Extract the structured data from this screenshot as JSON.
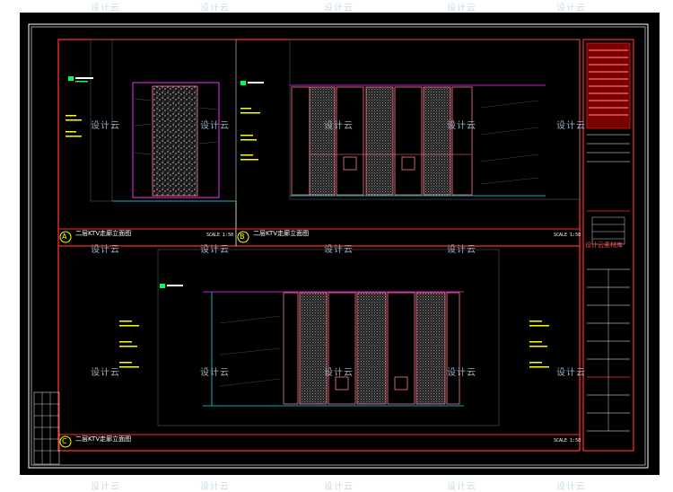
{
  "watermark": "设计云",
  "panels": {
    "a": {
      "marker": "A",
      "title": "二层KTV走廊立面图",
      "scale": "SCALE 1:50"
    },
    "b": {
      "marker": "B",
      "title": "二层KTV走廊立面图",
      "scale": "SCALE 1:50"
    },
    "c": {
      "marker": "C",
      "title": "二层KTV走廊立面图",
      "scale": "SCALE 1:50"
    }
  },
  "titleblock_stamp": "设计云素材库",
  "colors": {
    "background": "#000000",
    "frame": "#ffffff",
    "border": "#ff2a2a",
    "yellow": "#ffff00",
    "green": "#00ff55",
    "magenta": "#ff2aff",
    "cyan": "#00e5ff",
    "pink": "#ff7a8a"
  }
}
